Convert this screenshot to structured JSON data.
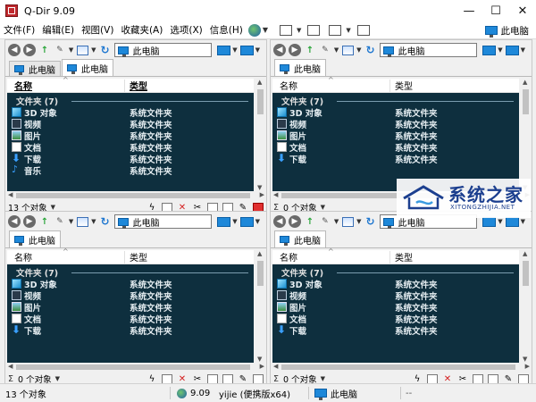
{
  "window": {
    "title": "Q-Dir 9.09",
    "controls": [
      "—",
      "☐",
      "✕"
    ]
  },
  "menu": {
    "items": [
      "文件(F)",
      "编辑(E)",
      "视图(V)",
      "收藏夹(A)",
      "选项(X)",
      "信息(H)"
    ],
    "location_label": "此电脑"
  },
  "panes": [
    {
      "address": "此电脑",
      "tabs": [
        "此电脑",
        "此电脑"
      ],
      "active_tab": 1,
      "columns": [
        "名称",
        "类型"
      ],
      "group": "文件夹 (7)",
      "rows": [
        {
          "name": "3D 对象",
          "type": "系统文件夹",
          "icon": "3d-objects-icon"
        },
        {
          "name": "视频",
          "type": "系统文件夹",
          "icon": "video-icon"
        },
        {
          "name": "图片",
          "type": "系统文件夹",
          "icon": "pictures-icon"
        },
        {
          "name": "文档",
          "type": "系统文件夹",
          "icon": "documents-icon"
        },
        {
          "name": "下载",
          "type": "系统文件夹",
          "icon": "download-icon"
        },
        {
          "name": "音乐",
          "type": "系统文件夹",
          "icon": "music-icon"
        }
      ],
      "status": "13 个对象"
    },
    {
      "address": "此电脑",
      "tabs": [
        "此电脑"
      ],
      "active_tab": 0,
      "columns": [
        "名称",
        "类型"
      ],
      "group": "文件夹 (7)",
      "rows": [
        {
          "name": "3D 对象",
          "type": "系统文件夹",
          "icon": "3d-objects-icon"
        },
        {
          "name": "视频",
          "type": "系统文件夹",
          "icon": "video-icon"
        },
        {
          "name": "图片",
          "type": "系统文件夹",
          "icon": "pictures-icon"
        },
        {
          "name": "文档",
          "type": "系统文件夹",
          "icon": "documents-icon"
        },
        {
          "name": "下载",
          "type": "系统文件夹",
          "icon": "download-icon"
        }
      ],
      "status": "0 个对象"
    },
    {
      "address": "此电脑",
      "tabs": [
        "此电脑"
      ],
      "active_tab": 0,
      "columns": [
        "名称",
        "类型"
      ],
      "group": "文件夹 (7)",
      "rows": [
        {
          "name": "3D 对象",
          "type": "系统文件夹",
          "icon": "3d-objects-icon"
        },
        {
          "name": "视频",
          "type": "系统文件夹",
          "icon": "video-icon"
        },
        {
          "name": "图片",
          "type": "系统文件夹",
          "icon": "pictures-icon"
        },
        {
          "name": "文档",
          "type": "系统文件夹",
          "icon": "documents-icon"
        },
        {
          "name": "下载",
          "type": "系统文件夹",
          "icon": "download-icon"
        }
      ],
      "status": "0 个对象"
    },
    {
      "address": "此电脑",
      "tabs": [
        "此电脑"
      ],
      "active_tab": 0,
      "columns": [
        "名称",
        "类型"
      ],
      "group": "文件夹 (7)",
      "rows": [
        {
          "name": "3D 对象",
          "type": "系统文件夹",
          "icon": "3d-objects-icon"
        },
        {
          "name": "视频",
          "type": "系统文件夹",
          "icon": "video-icon"
        },
        {
          "name": "图片",
          "type": "系统文件夹",
          "icon": "pictures-icon"
        },
        {
          "name": "文档",
          "type": "系统文件夹",
          "icon": "documents-icon"
        },
        {
          "name": "下载",
          "type": "系统文件夹",
          "icon": "download-icon"
        }
      ],
      "status": "0 个对象"
    }
  ],
  "statusbar": {
    "count": "13 个对象",
    "version": "9.09",
    "user": "yijie (便携版x64)",
    "location": "此电脑",
    "extra": "--"
  },
  "watermark": {
    "title": "系统之家",
    "subtitle": "XITONGZHIJIA.NET"
  },
  "colors": {
    "list_bg": "#0e2f3e",
    "list_text": "#e6eef2",
    "accent": "#1e88d9",
    "watermark": "#1c3f8f"
  }
}
